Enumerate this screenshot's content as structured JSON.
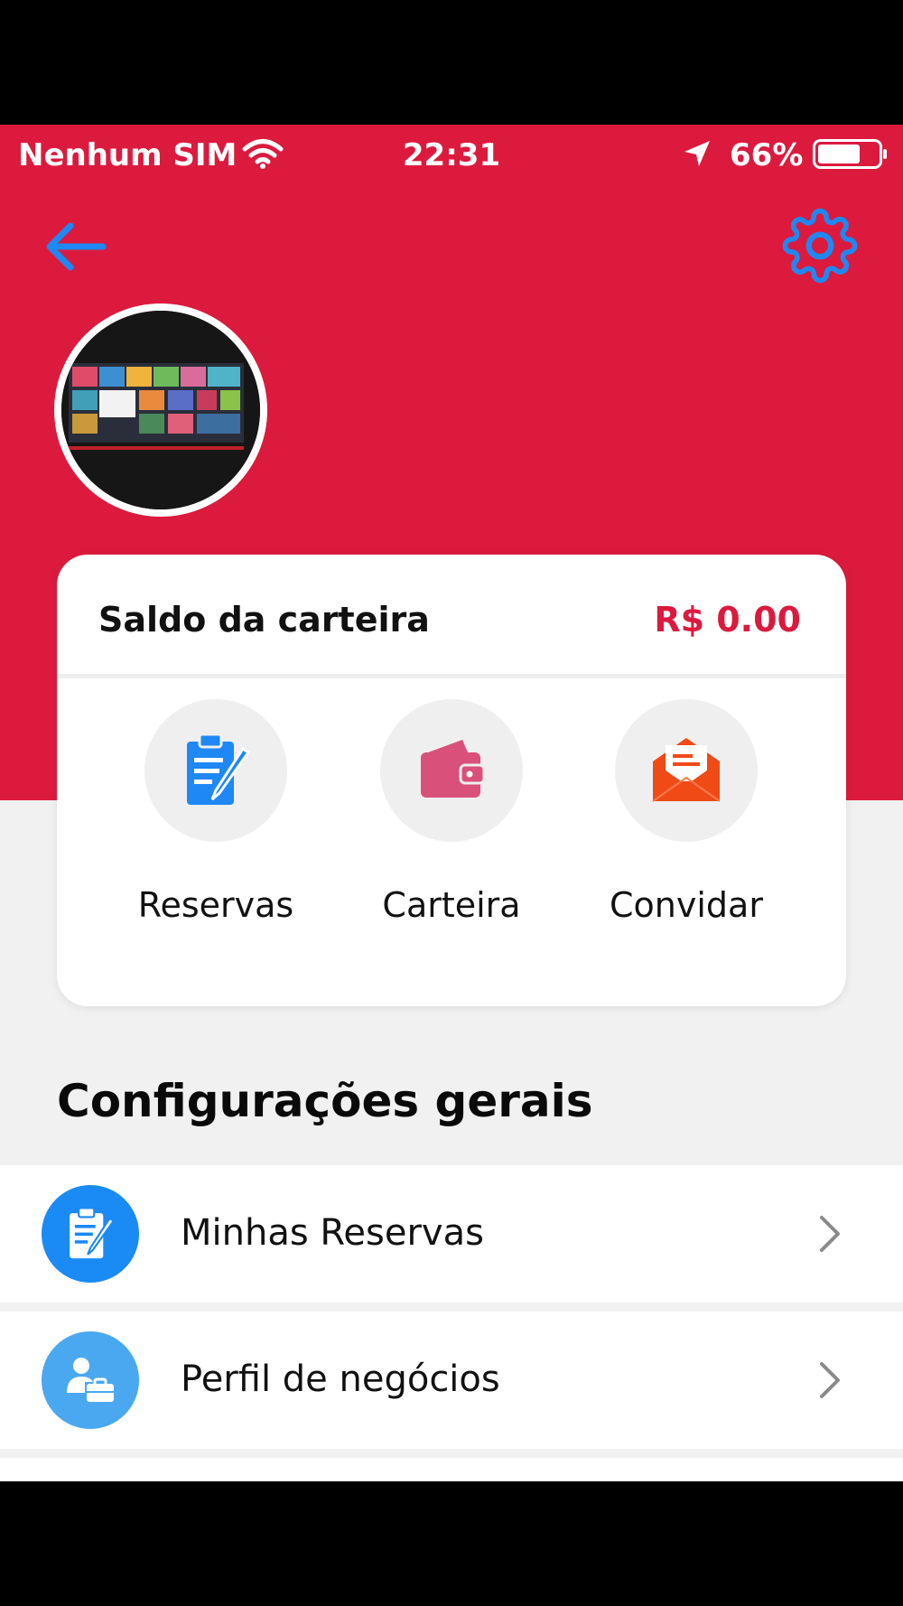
{
  "status_bar": {
    "carrier": "Nenhum SIM",
    "time": "22:31",
    "battery_percent": "66%"
  },
  "header": {
    "back_icon": "arrow-left-icon",
    "settings_icon": "gear-icon"
  },
  "wallet": {
    "label": "Saldo da carteira",
    "value": "R$ 0.00",
    "actions": [
      {
        "label": "Reservas",
        "icon": "clipboard-edit-icon",
        "color": "#1e88f5"
      },
      {
        "label": "Carteira",
        "icon": "wallet-icon",
        "color": "#d9507a"
      },
      {
        "label": "Convidar",
        "icon": "envelope-icon",
        "color": "#f04a16"
      }
    ]
  },
  "general_settings": {
    "title": "Configurações gerais",
    "items": [
      {
        "label": "Minhas Reservas",
        "icon": "clipboard-edit-icon",
        "color": "#1a8af5"
      },
      {
        "label": "Perfil de negócios",
        "icon": "business-profile-icon",
        "color": "#4aa8f0"
      }
    ]
  },
  "colors": {
    "primary_red": "#dc1a3e",
    "accent_blue": "#1e88f5",
    "background": "#f1f1f1"
  }
}
